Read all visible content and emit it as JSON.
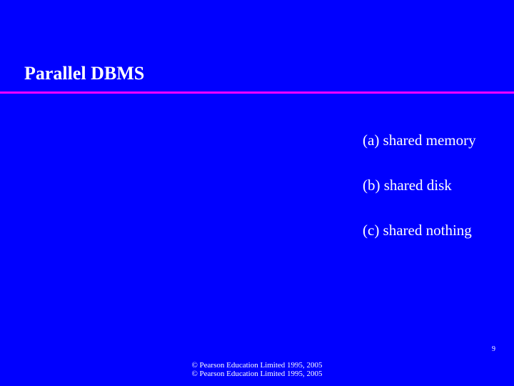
{
  "slide": {
    "title": "Parallel DBMS",
    "items": [
      {
        "label": "(a) shared memory"
      },
      {
        "label": "(b) shared disk"
      },
      {
        "label": "(c) shared nothing"
      }
    ],
    "footer": {
      "line1": "© Pearson Education Limited 1995, 2005",
      "line2": "© Pearson Education Limited 1995, 2005"
    },
    "page_number": "9"
  }
}
